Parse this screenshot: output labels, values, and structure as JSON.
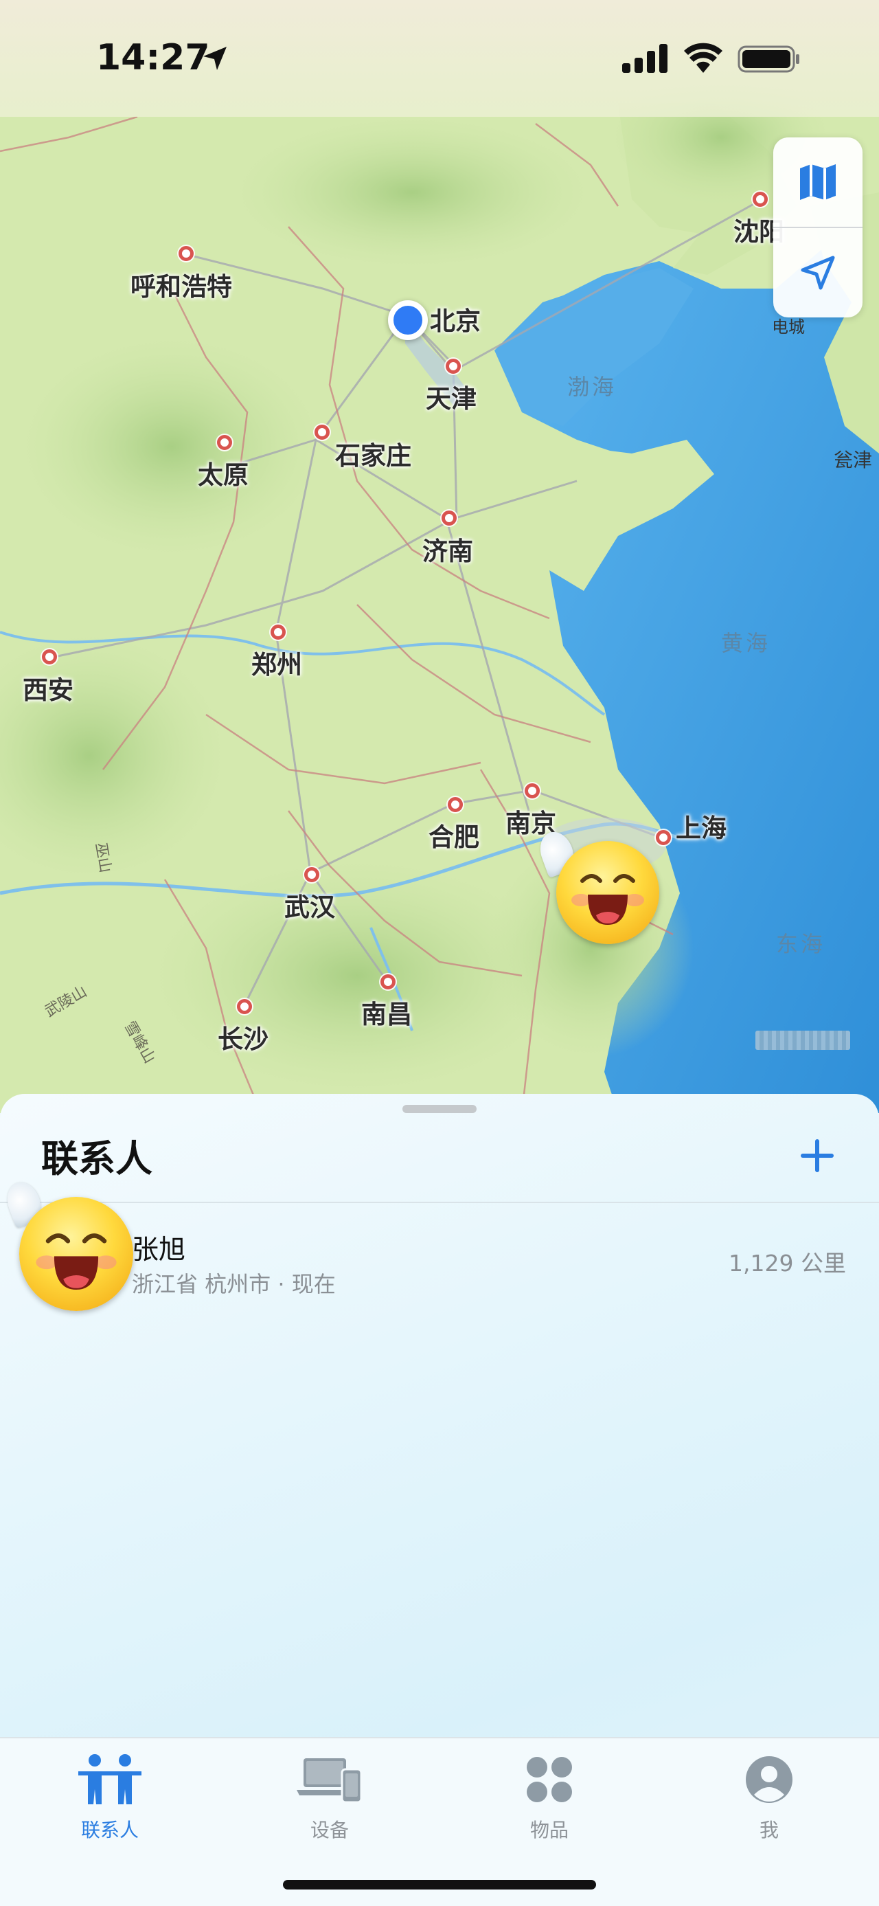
{
  "status_bar": {
    "time": "14:27"
  },
  "map": {
    "cities": [
      {
        "id": "beijing",
        "name": "北京"
      },
      {
        "id": "tianjin",
        "name": "天津"
      },
      {
        "id": "hohhot",
        "name": "呼和浩特"
      },
      {
        "id": "shijiazhuang",
        "name": "石家庄"
      },
      {
        "id": "taiyuan",
        "name": "太原"
      },
      {
        "id": "jinan",
        "name": "济南"
      },
      {
        "id": "zhengzhou",
        "name": "郑州"
      },
      {
        "id": "xian",
        "name": "西安"
      },
      {
        "id": "hefei",
        "name": "合肥"
      },
      {
        "id": "nanjing",
        "name": "南京"
      },
      {
        "id": "shanghai",
        "name": "上海"
      },
      {
        "id": "wuhan",
        "name": "武汉"
      },
      {
        "id": "nanchang",
        "name": "南昌"
      },
      {
        "id": "changsha",
        "name": "长沙"
      },
      {
        "id": "shenyang",
        "name": "沈阳"
      }
    ],
    "seas": {
      "bohai": "渤海",
      "huanghai": "黄海",
      "donghai": "东海"
    },
    "minor_labels": {
      "yingkou": "瓮津",
      "dianshi": "电城",
      "wulingshan": "武陵山",
      "xuefengshan": "雪峰山",
      "wushan": "巫山"
    },
    "icons": {
      "map_mode": "map-icon",
      "locate": "location-arrow-icon"
    },
    "colors": {
      "user_location": "#2f7bf5",
      "city_marker": "#d9544f",
      "sea": "#4aa7e6",
      "land": "#cfe6a8"
    }
  },
  "sheet": {
    "title": "联系人",
    "add_icon": "plus-icon",
    "accent": "#2a7de1",
    "people": [
      {
        "name": "张旭",
        "location": "浙江省 杭州市 · 现在",
        "distance": "1,129 公里"
      }
    ]
  },
  "tabs": [
    {
      "label": "联系人",
      "icon": "people-icon",
      "active": true
    },
    {
      "label": "设备",
      "icon": "devices-icon",
      "active": false
    },
    {
      "label": "物品",
      "icon": "items-icon",
      "active": false
    },
    {
      "label": "我",
      "icon": "me-icon",
      "active": false
    }
  ]
}
